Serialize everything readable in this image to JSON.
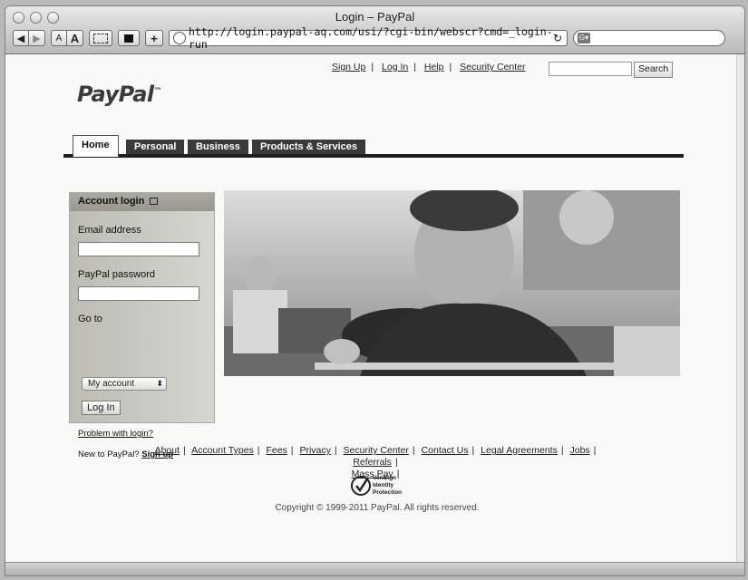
{
  "browser": {
    "window_title": "Login – PayPal",
    "url": "http://login.paypal-aq.com/usi/?cgi-bin/webscr?cmd=_login-run",
    "font_small": "A",
    "font_large": "A",
    "add_label": "+"
  },
  "header": {
    "top_links": [
      "Sign Up",
      "Log In",
      "Help",
      "Security Center"
    ],
    "search_button": "Search",
    "logo_text": "PayPal",
    "logo_mark": "™"
  },
  "tabs": [
    "Home",
    "Personal",
    "Business",
    "Products & Services"
  ],
  "login": {
    "title": "Account login",
    "email_label": "Email address",
    "password_label": "PayPal password",
    "goto_label": "Go to",
    "goto_value": "My account",
    "button": "Log In",
    "problem_link": "Problem with login?",
    "new_text": "New to PayPal?",
    "signup_link": "Sign up"
  },
  "footer": {
    "links": [
      "About",
      "Account Types",
      "Fees",
      "Privacy",
      "Security Center",
      "Contact Us",
      "Legal Agreements",
      "Jobs",
      "Referrals",
      "Mass Pay"
    ],
    "verisign": [
      "VeriSign",
      "Identity",
      "Protection"
    ],
    "copyright": "Copyright © 1999-2011 PayPal. All rights reserved."
  }
}
